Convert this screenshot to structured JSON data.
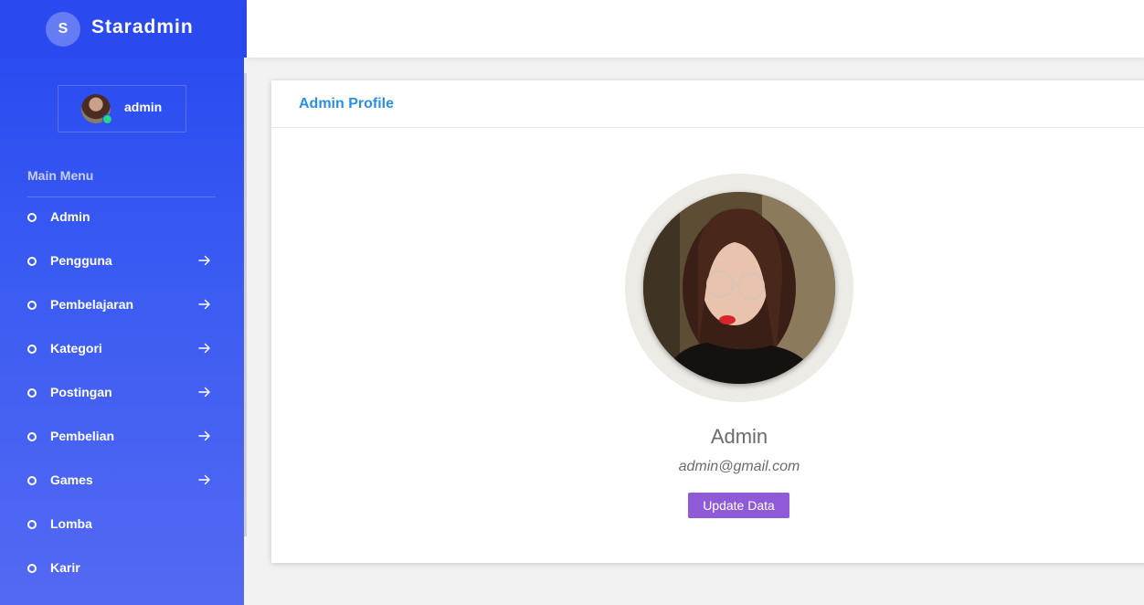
{
  "brand": {
    "initial": "S",
    "name": "Staradmin"
  },
  "user": {
    "name": "admin"
  },
  "menu": {
    "title": "Main Menu",
    "items": [
      {
        "label": "Admin",
        "has_arrow": false
      },
      {
        "label": "Pengguna",
        "has_arrow": true
      },
      {
        "label": "Pembelajaran",
        "has_arrow": true
      },
      {
        "label": "Kategori",
        "has_arrow": true
      },
      {
        "label": "Postingan",
        "has_arrow": true
      },
      {
        "label": "Pembelian",
        "has_arrow": true
      },
      {
        "label": "Games",
        "has_arrow": true
      },
      {
        "label": "Lomba",
        "has_arrow": false
      },
      {
        "label": "Karir",
        "has_arrow": false
      }
    ]
  },
  "card": {
    "title": "Admin Profile",
    "profile_name": "Admin",
    "email": "admin@gmail.com",
    "update_button": "Update Data"
  },
  "colors": {
    "sidebar_top": "#2647f0",
    "sidebar_bottom": "#5469f3",
    "card_title": "#2b8fe0",
    "button": "#8e5ad8",
    "status_online": "#24d68c"
  },
  "icons": {
    "menu_arrow": "arrow-right-icon",
    "menu_bullet": "circle-bullet-icon",
    "status": "online-status-icon"
  }
}
